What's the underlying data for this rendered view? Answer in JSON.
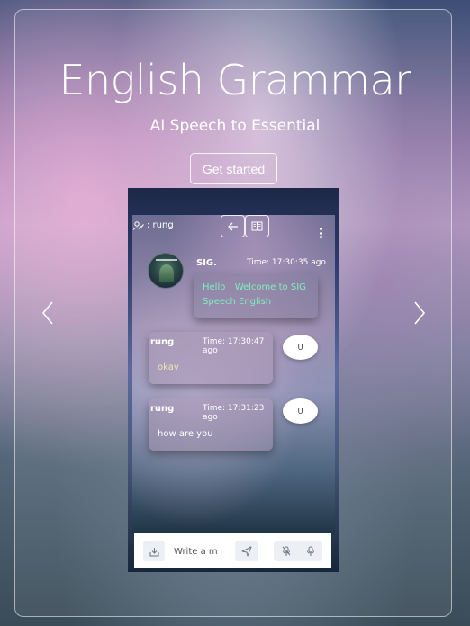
{
  "hero": {
    "title": "English Grammar",
    "subtitle": "AI Speech to Essential",
    "cta_label": "Get started"
  },
  "carousel": {
    "prev_icon": "chevron-left-icon",
    "next_icon": "chevron-right-icon"
  },
  "chat": {
    "user_label": ": rung",
    "toolbar": {
      "back_icon": "arrow-left-icon",
      "book_icon": "book-icon",
      "menu_icon": "kebab-menu-icon"
    },
    "messages": [
      {
        "sender": "SIG.",
        "time": "Time: 17:30:35 ago",
        "text": "Hello ! Welcome to SIG Speech English",
        "color": "#7ff0b8"
      },
      {
        "sender": "rung",
        "time": "Time: 17:30:47 ago",
        "text": "okay",
        "avatar": "U",
        "color": "#f3e6a5"
      },
      {
        "sender": "rung",
        "time": "Time: 17:31:23 ago",
        "text": "how are you",
        "avatar": "U",
        "color": "#ffffff"
      }
    ],
    "input": {
      "placeholder": "Write a m",
      "value": ""
    }
  },
  "colors": {
    "accent_green": "#7ff0b8",
    "card_border": "#ffffff"
  }
}
